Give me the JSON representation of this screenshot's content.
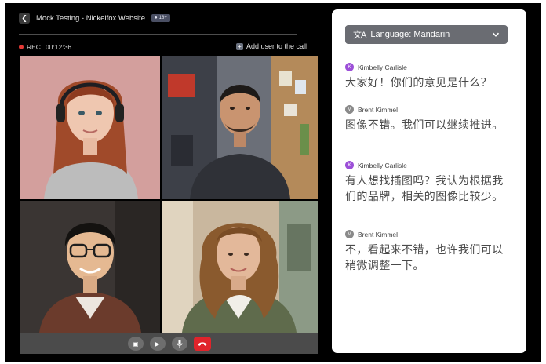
{
  "call": {
    "title": "Mock Testing - Nickelfox Website",
    "badge": "18+",
    "rec_label": "REC",
    "rec_time": "00:12:36",
    "add_user": "Add user to the call"
  },
  "language": {
    "label": "Language: Mandarin"
  },
  "messages": [
    {
      "initial": "K",
      "sender": "Kimbelly Carlisle",
      "text": "大家好！你们的意见是什么？"
    },
    {
      "initial": "M",
      "sender": "Brent Kimmel",
      "text": "图像不错。我们可以继续推进。"
    },
    {
      "initial": "K",
      "sender": "Kimbelly Carlisle",
      "text": "有人想找插图吗？我认为根据我们的品牌，相关的图像比较少。"
    },
    {
      "initial": "M",
      "sender": "Brent Kimmel",
      "text": "不，看起来不错，也许我们可以稍微调整一下。"
    }
  ],
  "colors": {
    "accent_purple": "#9c4fd8",
    "hangup_red": "#e0242b",
    "rec_red": "#e53935"
  }
}
